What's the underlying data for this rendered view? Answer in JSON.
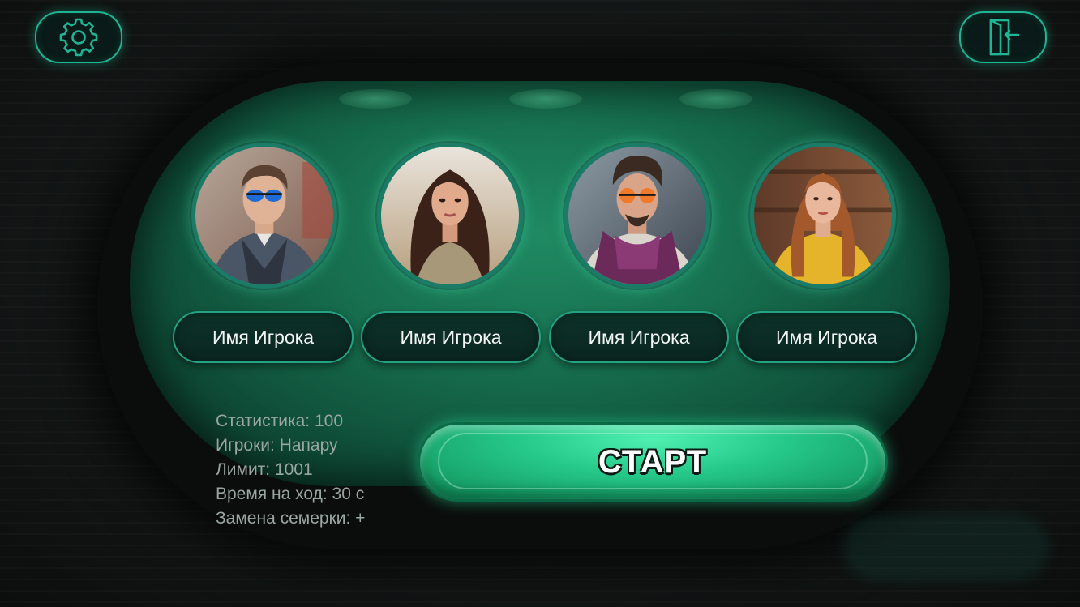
{
  "top_bar": {
    "settings_icon": "gear-icon",
    "exit_icon": "exit-door-icon",
    "accent_color": "#1fb594"
  },
  "players": [
    {
      "name": "Имя Игрока",
      "avatar": "man-blue-sunglasses"
    },
    {
      "name": "Имя Игрока",
      "avatar": "woman-dark-hair"
    },
    {
      "name": "Имя Игрока",
      "avatar": "man-orange-sunglasses-scarf"
    },
    {
      "name": "Имя Игрока",
      "avatar": "woman-yellow-sweater"
    }
  ],
  "game_settings": {
    "statistics": "Статистика: 100",
    "players_mode": "Игроки: Напару",
    "limit": "Лимит: 1001",
    "turn_time": "Время на ход: 30 с",
    "seven_swap": "Замена семерки: +"
  },
  "start_button": {
    "label": "СТАРТ",
    "color": "#26c98a"
  },
  "colors": {
    "felt": "#177050",
    "background": "#121615",
    "name_pill_border": "#24a383",
    "stats_text": "#9aa6a2"
  }
}
